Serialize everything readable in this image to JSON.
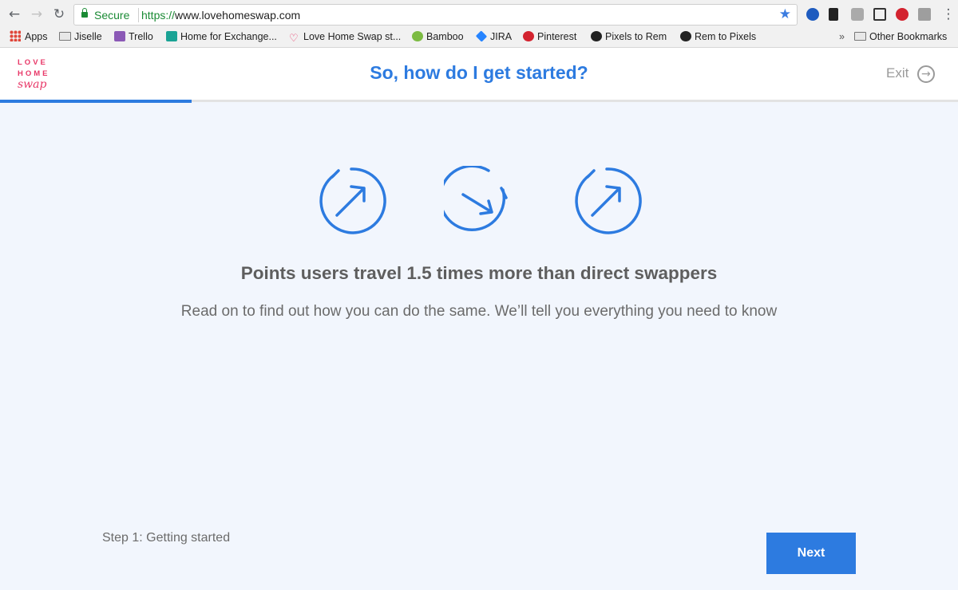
{
  "browser": {
    "secure_label": "Secure",
    "url_scheme": "https://",
    "url_host": "www.lovehomeswap.com",
    "nav_icons": [
      "back-icon",
      "forward-icon",
      "reload-icon"
    ],
    "bookmarks": [
      {
        "label": "Apps",
        "icon": "apps-icon"
      },
      {
        "label": "Jiselle",
        "icon": "folder-icon"
      },
      {
        "label": "Trello",
        "icon": "trello-icon"
      },
      {
        "label": "Home for Exchange...",
        "icon": "home-exchange-icon"
      },
      {
        "label": "Love Home Swap st...",
        "icon": "heart-icon"
      },
      {
        "label": "Bamboo",
        "icon": "bamboo-icon"
      },
      {
        "label": "JIRA",
        "icon": "jira-icon"
      },
      {
        "label": "Pinterest",
        "icon": "pinterest-icon"
      },
      {
        "label": "Pixels to Rem",
        "icon": "pixels-icon"
      },
      {
        "label": "Rem to Pixels",
        "icon": "pixels-icon"
      }
    ],
    "overflow_label": "»",
    "other_bookmarks": "Other Bookmarks"
  },
  "header": {
    "logo_line1": "LOVE",
    "logo_line2": "HOME",
    "logo_line3": "swap",
    "title": "So, how do I get started?",
    "exit_label": "Exit"
  },
  "progress": {
    "fraction": 0.2
  },
  "main": {
    "icons": [
      "arrow-up-right-icon",
      "arrow-down-right-icon",
      "arrow-up-right-icon"
    ],
    "headline": "Points users travel 1.5 times more than direct swappers",
    "subline": "Read on to find out how you can do the same. We’ll tell you everything you need to know"
  },
  "footer": {
    "step_label": "Step 1: Getting started",
    "next_label": "Next"
  },
  "colors": {
    "brand_blue": "#2d7be0",
    "brand_pink": "#e83868",
    "background": "#f2f6fd"
  }
}
